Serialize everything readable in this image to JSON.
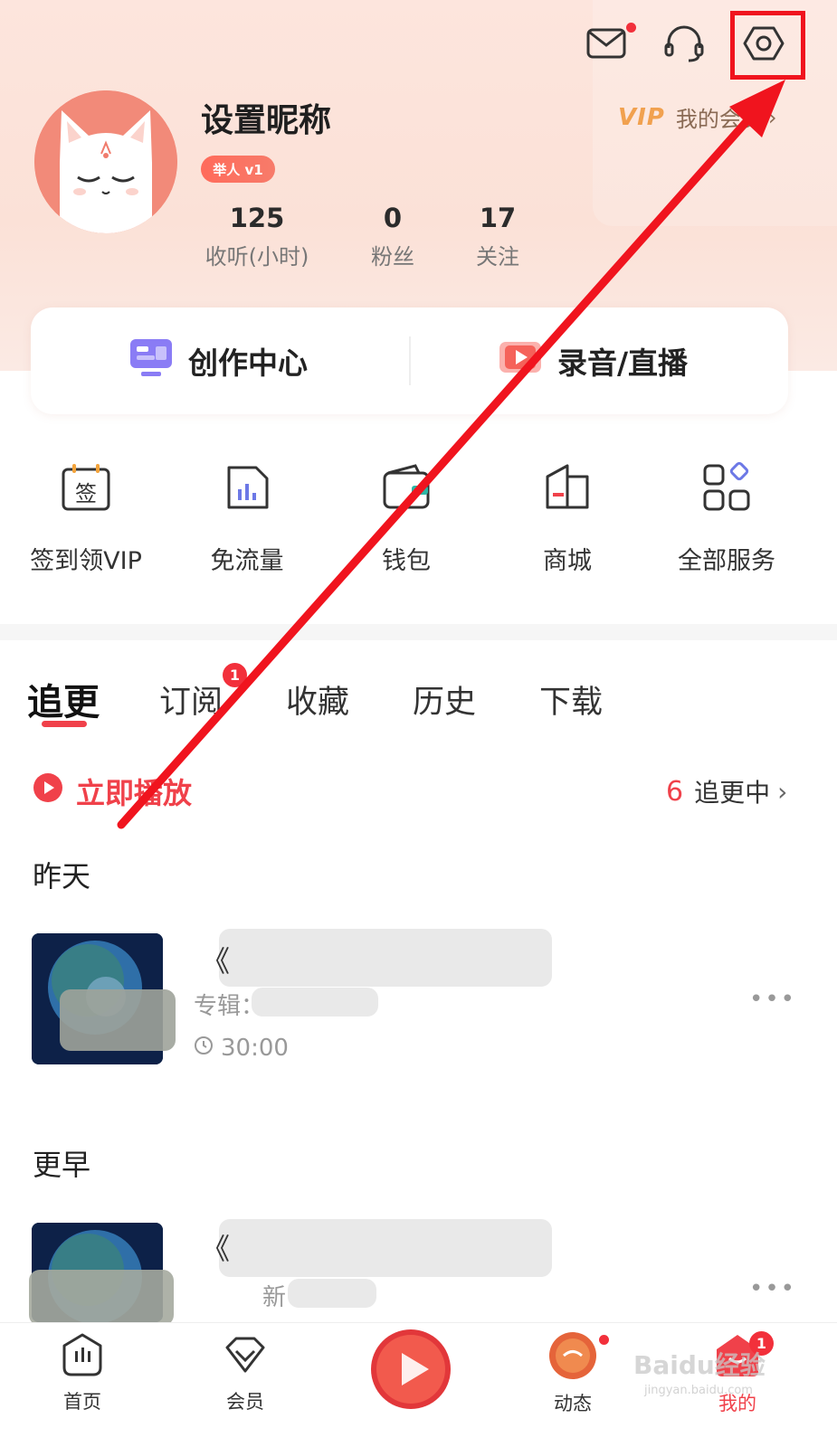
{
  "header": {
    "nickname": "设置昵称",
    "level_badge": "举人 v1",
    "vip_logo": "VIP",
    "vip_link": "我的会员",
    "icons": [
      "mail-icon",
      "headset-icon",
      "settings-icon"
    ]
  },
  "stats": [
    {
      "value": "125",
      "label": "收听(小时)"
    },
    {
      "value": "0",
      "label": "粉丝"
    },
    {
      "value": "17",
      "label": "关注"
    }
  ],
  "creator": {
    "center_label": "创作中心",
    "record_label": "录音/直播"
  },
  "services": [
    {
      "label": "签到领VIP",
      "icon": "sign-in-icon",
      "glyph": "签"
    },
    {
      "label": "免流量",
      "icon": "data-free-icon"
    },
    {
      "label": "钱包",
      "icon": "wallet-icon"
    },
    {
      "label": "商城",
      "icon": "store-icon"
    },
    {
      "label": "全部服务",
      "icon": "all-services-icon"
    }
  ],
  "tabs": [
    {
      "label": "追更",
      "active": true
    },
    {
      "label": "订阅",
      "badge": "1"
    },
    {
      "label": "收藏"
    },
    {
      "label": "历史"
    },
    {
      "label": "下载"
    }
  ],
  "play_all": "立即播放",
  "updating": {
    "count": "6",
    "label": "追更中"
  },
  "sections": [
    {
      "title": "昨天",
      "item": {
        "title_prefix": "《",
        "meta_prefix": "专辑：",
        "duration": "30:00",
        "more": "•••"
      }
    },
    {
      "title": "更早",
      "item": {
        "title_prefix": "《",
        "meta_prefix": "新",
        "more": "•••"
      }
    }
  ],
  "bottom_nav": [
    {
      "label": "首页",
      "icon": "home-icon"
    },
    {
      "label": "会员",
      "icon": "vip-diamond-icon"
    },
    {
      "label": "",
      "icon": "morning-news-icon"
    },
    {
      "label": "动态",
      "icon": "feed-icon",
      "badge_dot": true
    },
    {
      "label": "我的",
      "icon": "mine-icon",
      "active": true,
      "badge": "1"
    }
  ],
  "colors": {
    "accent": "#f0414a",
    "annotation": "#f0141e",
    "vip_gold": "#f1a14f"
  },
  "watermark": {
    "brand": "Baidu经验",
    "url": "jingyan.baidu.com"
  }
}
